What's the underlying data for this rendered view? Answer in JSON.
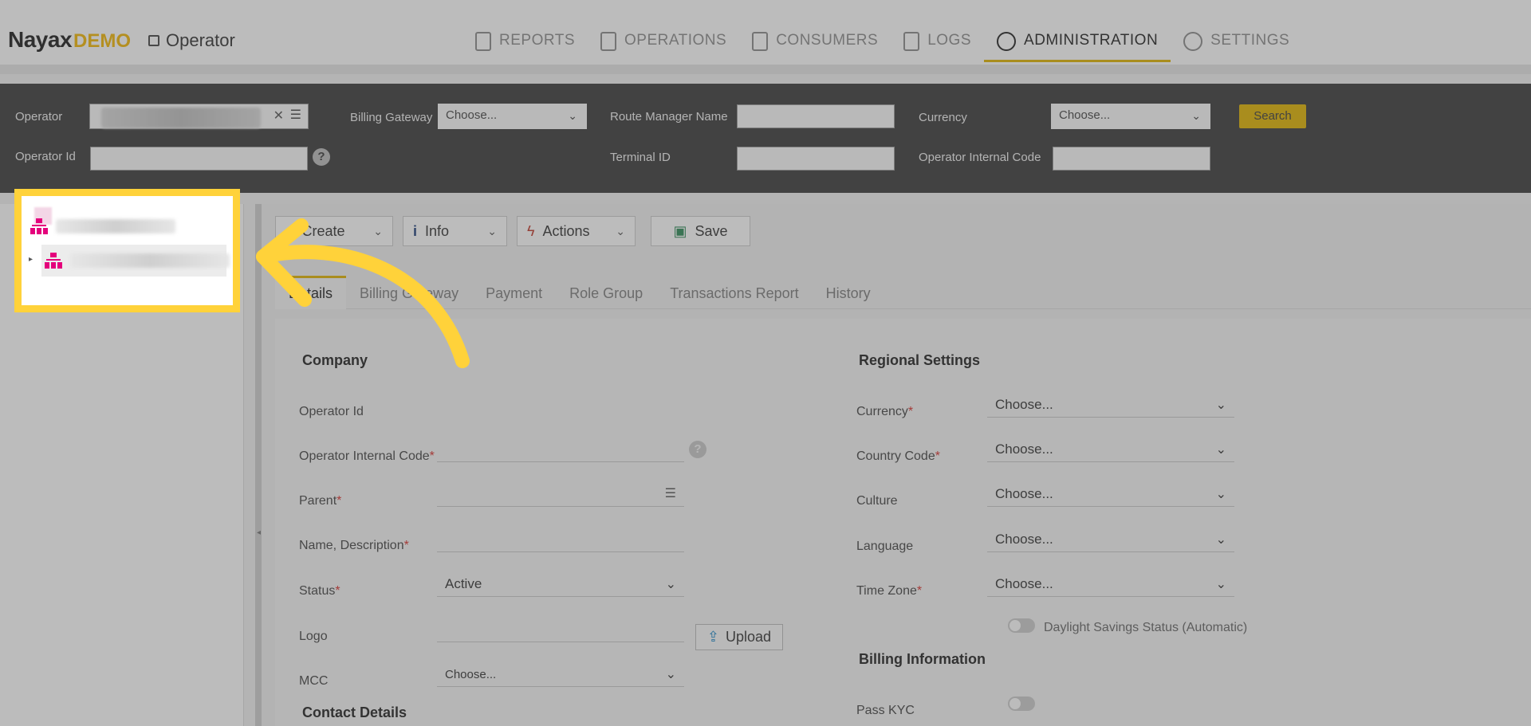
{
  "header": {
    "logo_main": "Nayax",
    "logo_demo": "DEMO",
    "page_title": "Operator"
  },
  "nav": [
    {
      "label": "REPORTS",
      "icon": "document-icon"
    },
    {
      "label": "OPERATIONS",
      "icon": "tablet-icon"
    },
    {
      "label": "CONSUMERS",
      "icon": "id-card-icon"
    },
    {
      "label": "LOGS",
      "icon": "calendar-icon"
    },
    {
      "label": "ADMINISTRATION",
      "icon": "gauge-icon",
      "active": true
    },
    {
      "label": "SETTINGS",
      "icon": "gear-icon"
    }
  ],
  "filters": {
    "operator_label": "Operator",
    "operator_id_label": "Operator Id",
    "billing_gateway_label": "Billing Gateway",
    "billing_gateway_value": "Choose...",
    "route_manager_label": "Route Manager Name",
    "terminal_id_label": "Terminal ID",
    "currency_label": "Currency",
    "currency_value": "Choose...",
    "operator_internal_code_label": "Operator Internal Code",
    "search_label": "Search"
  },
  "toolbar": {
    "create": "Create",
    "info": "Info",
    "actions": "Actions",
    "save": "Save"
  },
  "tabs": [
    "Details",
    "Billing Gateway",
    "Payment",
    "Role Group",
    "Transactions Report",
    "History"
  ],
  "company": {
    "title": "Company",
    "operator_id": "Operator Id",
    "internal_code": "Operator Internal Code",
    "parent": "Parent",
    "name_desc": "Name, Description",
    "status": "Status",
    "status_value": "Active",
    "logo": "Logo",
    "upload": "Upload",
    "mcc": "MCC",
    "mcc_value": "Choose...",
    "contact_title": "Contact Details"
  },
  "regional": {
    "title": "Regional Settings",
    "currency": "Currency",
    "country_code": "Country Code",
    "culture": "Culture",
    "language": "Language",
    "time_zone": "Time Zone",
    "choose": "Choose...",
    "dst_label": "Daylight Savings Status (Automatic)"
  },
  "billing": {
    "title": "Billing Information",
    "pass_kyc": "Pass KYC"
  },
  "colors": {
    "accent": "#e0b400",
    "highlight_box": "#ffd23a",
    "tree_icon": "#e4007c",
    "filter_bg": "#3a3a3a"
  }
}
